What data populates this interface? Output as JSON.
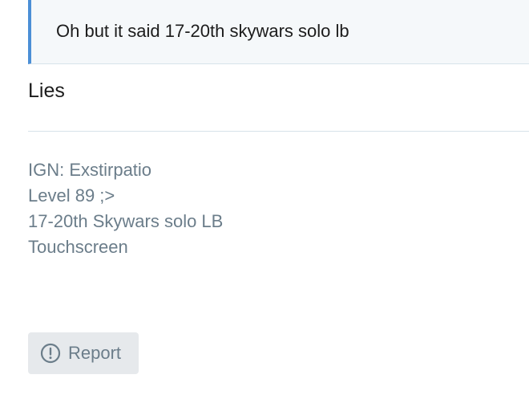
{
  "quote": {
    "text": "Oh but it said 17-20th skywars solo lb"
  },
  "message": {
    "text": "Lies"
  },
  "signature": {
    "lines": [
      "IGN: Exstirpatio",
      "Level 89 ;>",
      "17-20th Skywars solo LB",
      "Touchscreen"
    ]
  },
  "actions": {
    "report_label": "Report",
    "report_icon": "alert-circle-icon"
  },
  "colors": {
    "quote_accent": "#4b8fd6",
    "quote_background": "#f5f8fa",
    "muted_text": "#6b7d8a",
    "button_background": "#e6e9ec"
  }
}
